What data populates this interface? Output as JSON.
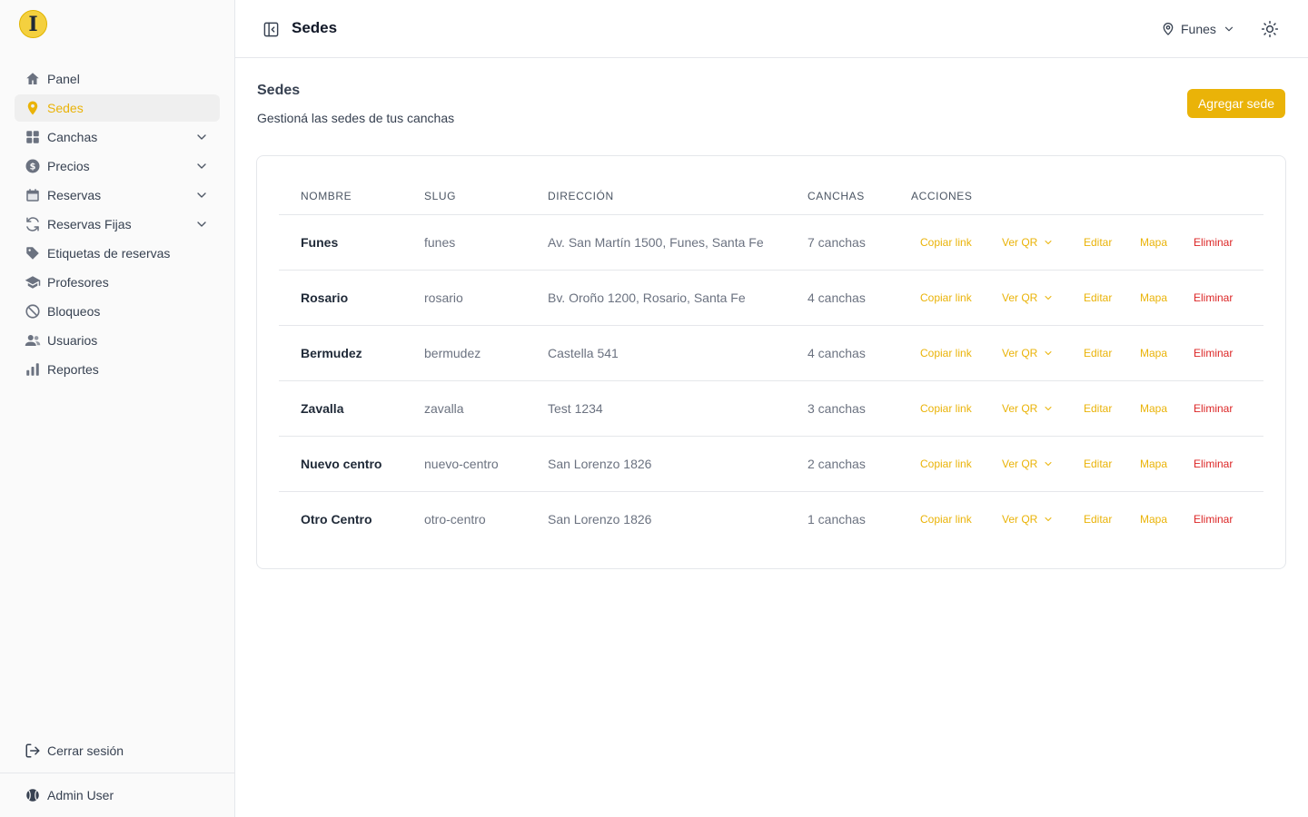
{
  "sidebar": {
    "items": [
      {
        "label": "Panel",
        "icon": "home-icon",
        "active": false,
        "expandable": false
      },
      {
        "label": "Sedes",
        "icon": "map-pin-icon",
        "active": true,
        "expandable": false
      },
      {
        "label": "Canchas",
        "icon": "grid-icon",
        "active": false,
        "expandable": true
      },
      {
        "label": "Precios",
        "icon": "dollar-icon",
        "active": false,
        "expandable": true
      },
      {
        "label": "Reservas",
        "icon": "calendar-icon",
        "active": false,
        "expandable": true
      },
      {
        "label": "Reservas Fijas",
        "icon": "refresh-icon",
        "active": false,
        "expandable": true
      },
      {
        "label": "Etiquetas de reservas",
        "icon": "tag-icon",
        "active": false,
        "expandable": false
      },
      {
        "label": "Profesores",
        "icon": "graduation-cap-icon",
        "active": false,
        "expandable": false
      },
      {
        "label": "Bloqueos",
        "icon": "ban-icon",
        "active": false,
        "expandable": false
      },
      {
        "label": "Usuarios",
        "icon": "users-icon",
        "active": false,
        "expandable": false
      },
      {
        "label": "Reportes",
        "icon": "bar-chart-icon",
        "active": false,
        "expandable": false
      }
    ],
    "logout_label": "Cerrar sesión",
    "user_name": "Admin User"
  },
  "header": {
    "title": "Sedes",
    "location": "Funes"
  },
  "main": {
    "title": "Sedes",
    "subtitle": "Gestioná las sedes de tus canchas",
    "add_button": "Agregar sede",
    "columns": [
      "Nombre",
      "Slug",
      "Dirección",
      "Canchas",
      "Acciones"
    ],
    "actions": {
      "copy": "Copiar link",
      "qr": "Ver QR",
      "edit": "Editar",
      "map": "Mapa",
      "delete": "Eliminar"
    },
    "rows": [
      {
        "name": "Funes",
        "slug": "funes",
        "address": "Av. San Martín 1500, Funes, Santa Fe",
        "courts": "7 canchas"
      },
      {
        "name": "Rosario",
        "slug": "rosario",
        "address": "Bv. Oroño 1200, Rosario, Santa Fe",
        "courts": "4 canchas"
      },
      {
        "name": "Bermudez",
        "slug": "bermudez",
        "address": "Castella 541",
        "courts": "4 canchas"
      },
      {
        "name": "Zavalla",
        "slug": "zavalla",
        "address": "Test 1234",
        "courts": "3 canchas"
      },
      {
        "name": "Nuevo centro",
        "slug": "nuevo-centro",
        "address": "San Lorenzo 1826",
        "courts": "2 canchas"
      },
      {
        "name": "Otro Centro",
        "slug": "otro-centro",
        "address": "San Lorenzo 1826",
        "courts": "1 canchas"
      }
    ]
  },
  "colors": {
    "accent": "#eab308",
    "danger": "#dc2626",
    "text": "#374151",
    "muted": "#6b7280",
    "border": "#e5e7eb"
  }
}
